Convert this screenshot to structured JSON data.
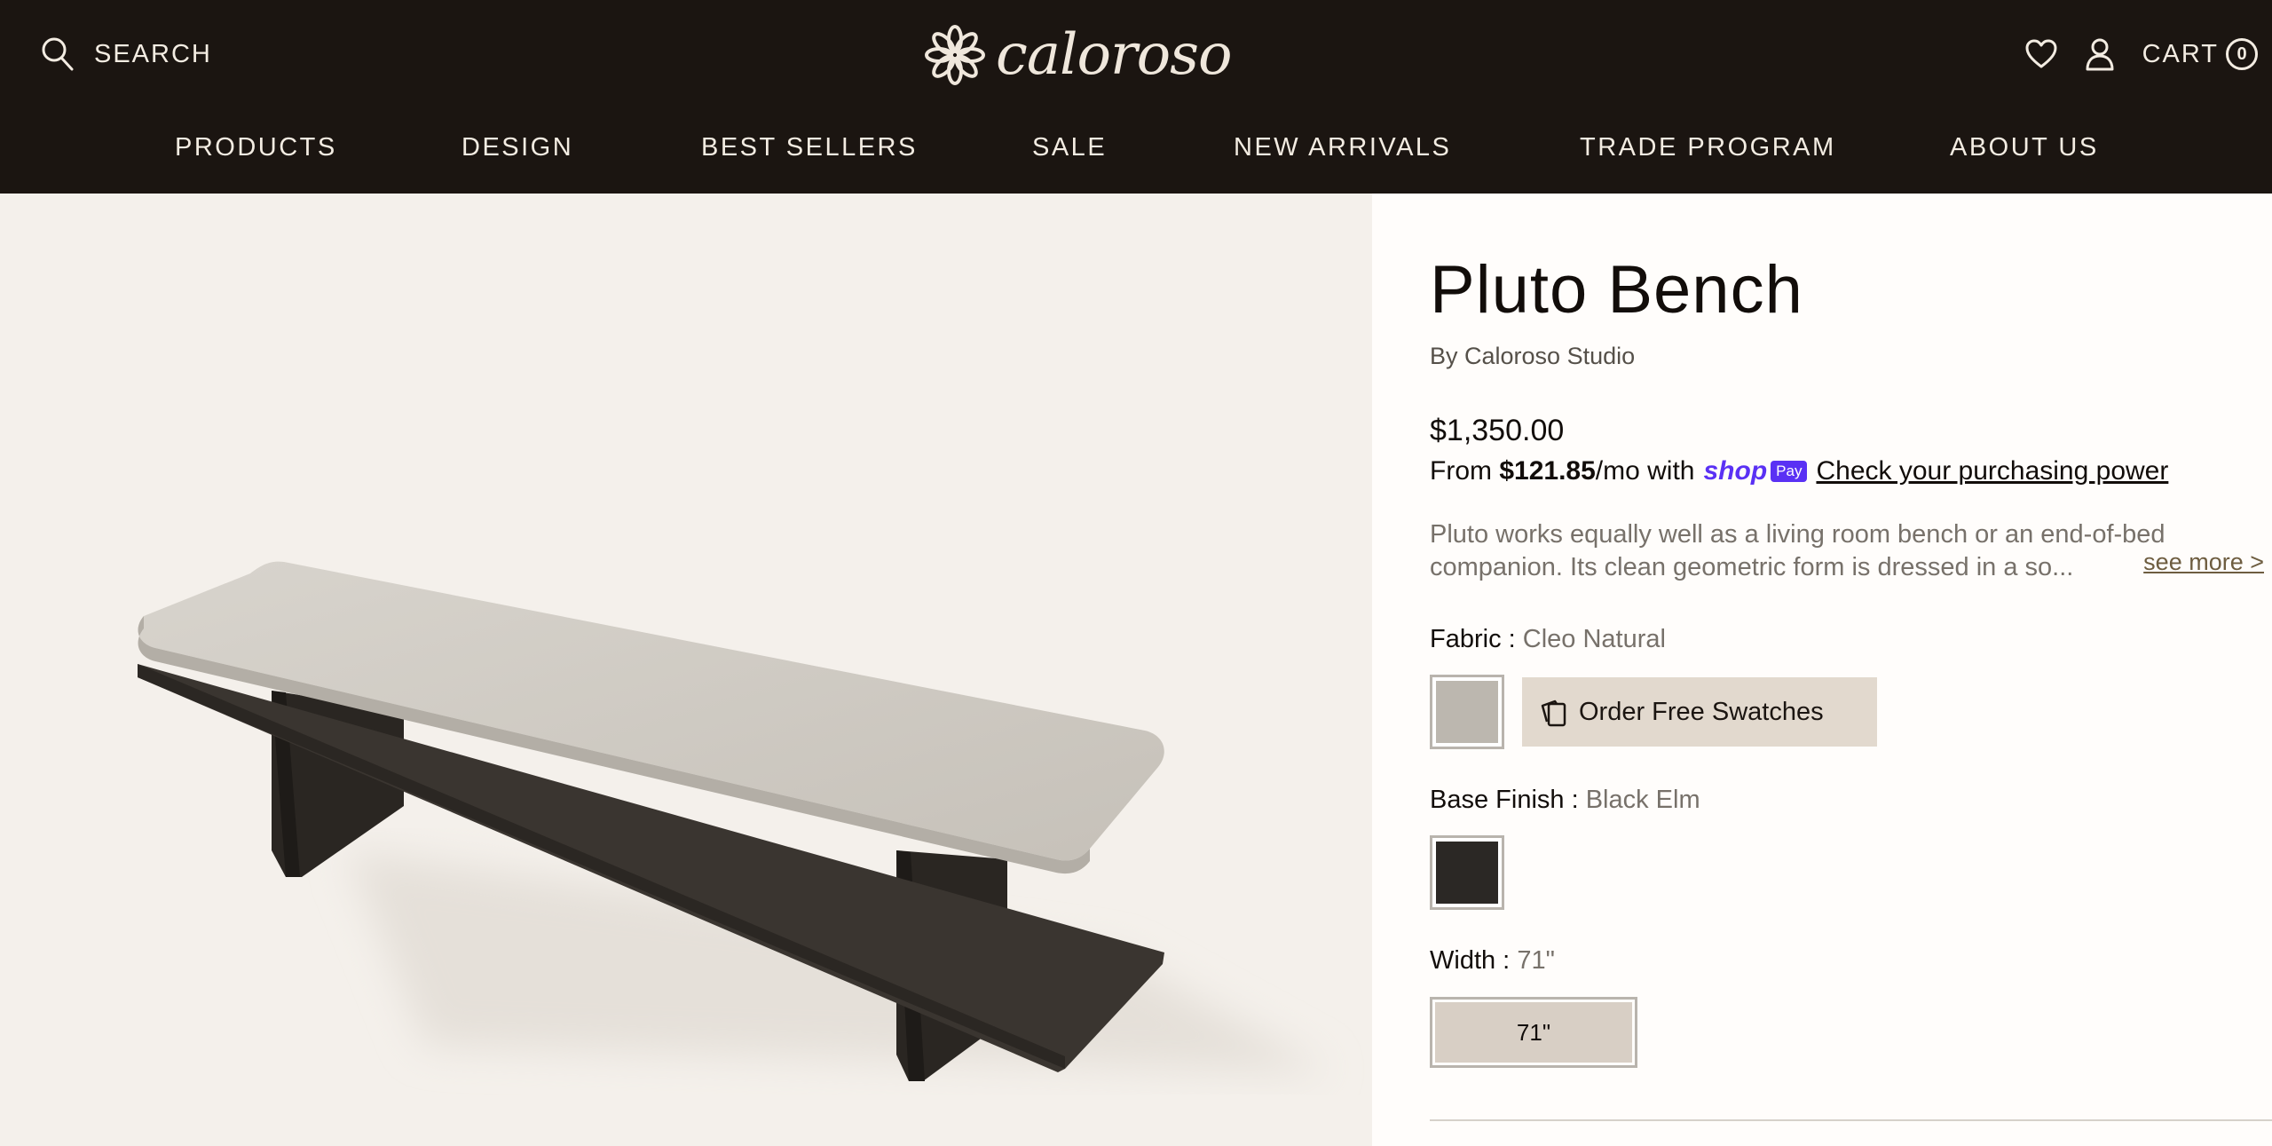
{
  "header": {
    "search_label": "SEARCH",
    "logo_text": "caloroso",
    "cart_label": "CART",
    "cart_count": "0"
  },
  "nav": {
    "items": [
      "PRODUCTS",
      "DESIGN",
      "BEST SELLERS",
      "SALE",
      "NEW ARRIVALS",
      "TRADE PROGRAM",
      "ABOUT US"
    ]
  },
  "product": {
    "title": "Pluto Bench",
    "byline": "By Caloroso Studio",
    "price": "$1,350.00",
    "installment_prefix": "From",
    "installment_amount": "$121.85",
    "installment_suffix": "/mo with",
    "shoppay_shop": "shop",
    "shoppay_pay": "Pay",
    "installment_link": "Check your purchasing power",
    "description": "Pluto works equally well as a living room bench or an end-of-bed companion. Its clean geometric form is dressed in a so...",
    "see_more": "see more >"
  },
  "options": {
    "fabric_label": "Fabric :",
    "fabric_value": "Cleo Natural",
    "fabric_swatch_color": "#bcb7af",
    "order_swatches_label": "Order Free Swatches",
    "base_label": "Base Finish :",
    "base_value": "Black Elm",
    "base_swatch_color": "#2b2825",
    "width_label": "Width :",
    "width_value": "71\"",
    "width_button": "71\""
  },
  "colors": {
    "header_bg": "#1b1511",
    "header_text": "#f3ece2",
    "gallery_bg": "#f4f0eb",
    "accent_button": "#e2d9ce",
    "shoppay_purple": "#5a31f4"
  }
}
